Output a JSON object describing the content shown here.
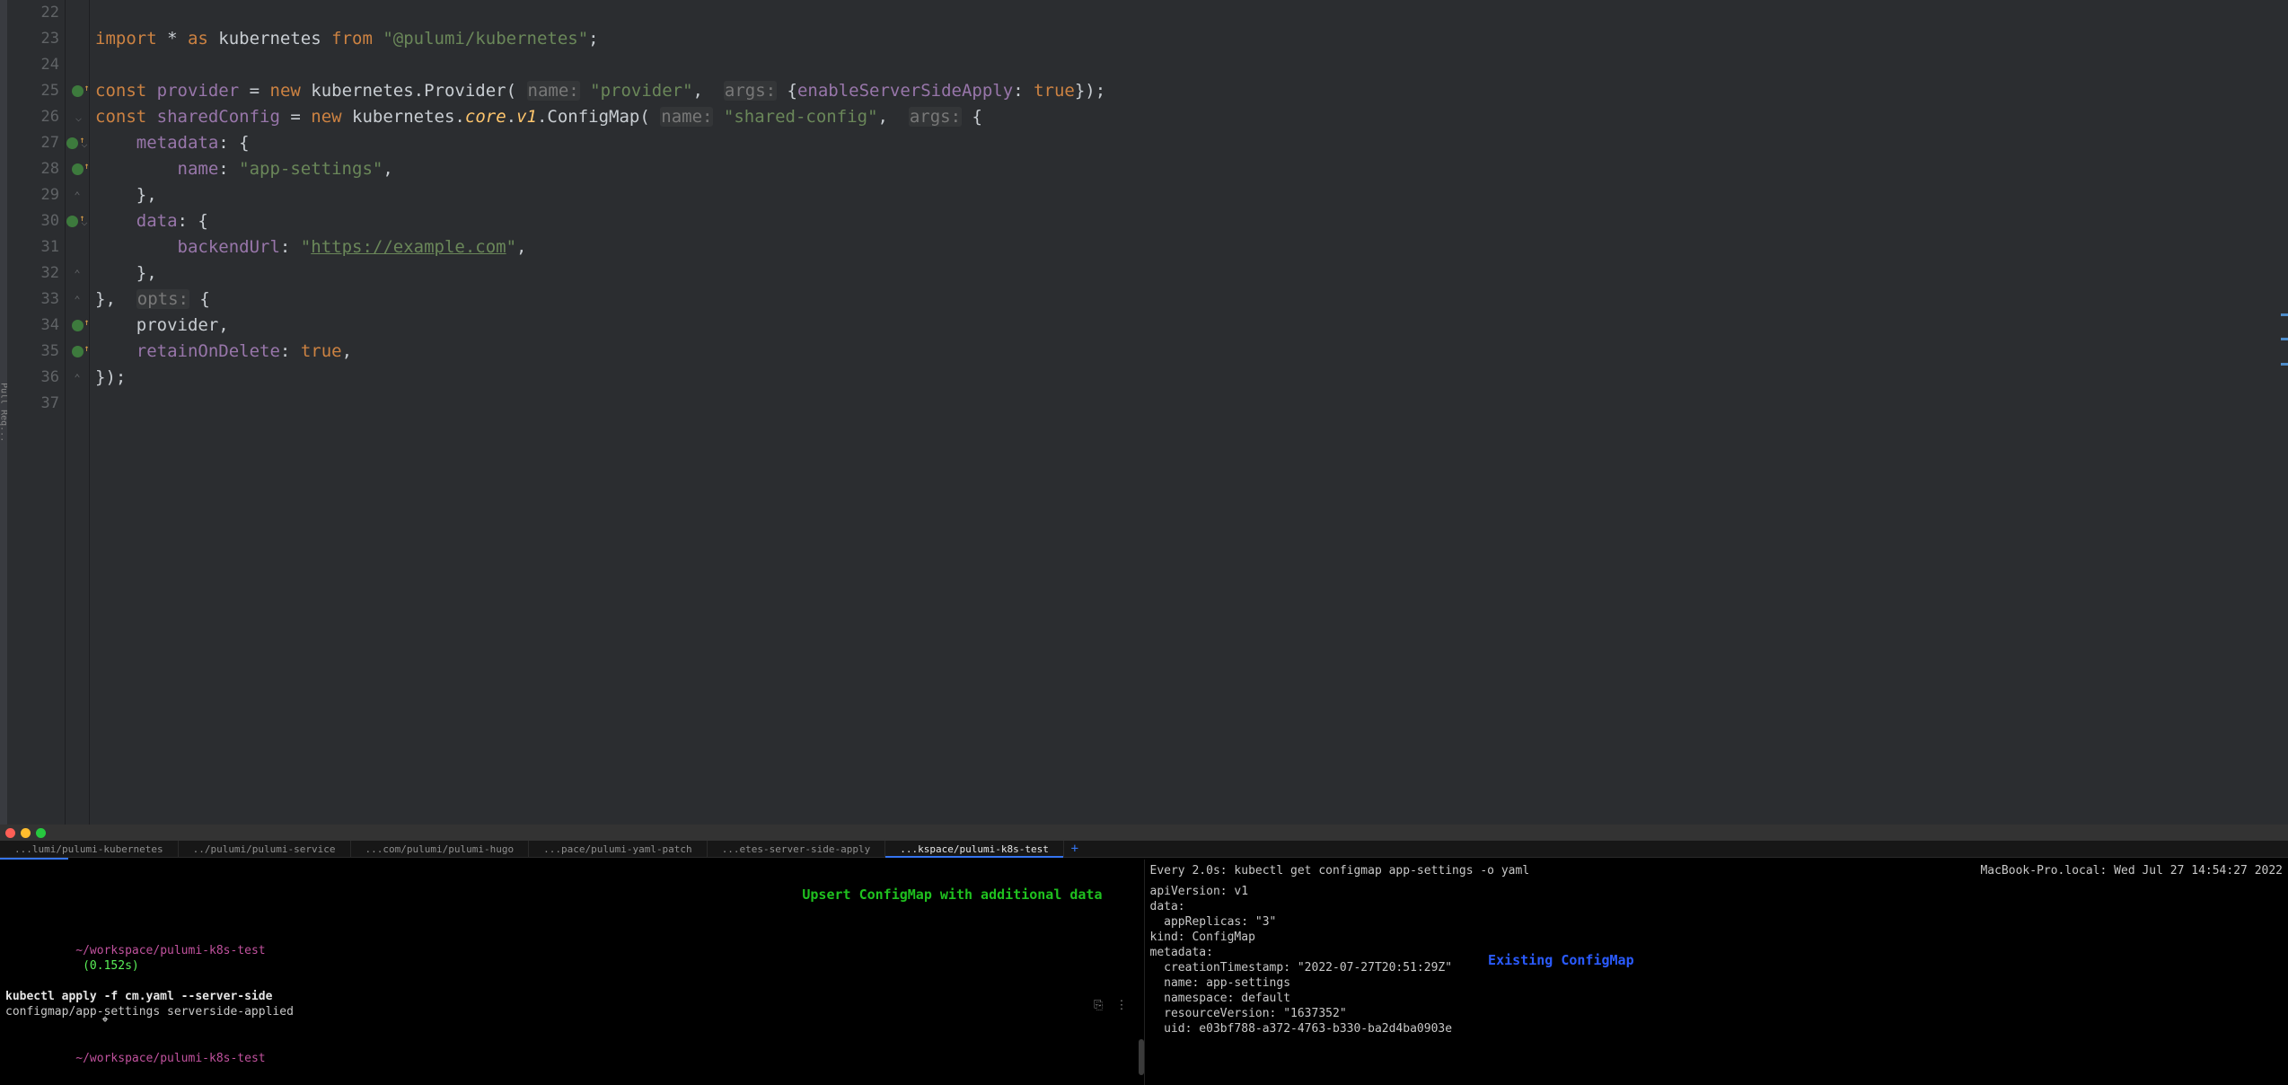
{
  "sidebar_label": "Pull Req...",
  "editor": {
    "lines": [
      {
        "n": 22,
        "mark": "",
        "html": ""
      },
      {
        "n": 23,
        "mark": "",
        "html": "<span class='kw'>import</span> * <span class='kw'>as</span> kubernetes <span class='kw'>from</span> <span class='str'>\"@pulumi/kubernetes\"</span>;"
      },
      {
        "n": 24,
        "mark": "",
        "html": ""
      },
      {
        "n": 25,
        "mark": "hint",
        "html": "<span class='kw'>const</span> <span class='pp'>provider</span> = <span class='kw'>new</span> kubernetes.Provider( <span class='ht'>name:</span> <span class='str'>\"provider\"</span>,  <span class='ht'>args:</span> {<span class='pp'>enableServerSideApply</span>: <span class='kw'>true</span>});"
      },
      {
        "n": 26,
        "mark": "fold",
        "html": "<span class='kw'>const</span> <span class='pp'>sharedConfig</span> = <span class='kw'>new</span> kubernetes.<span class='it'>core</span>.<span class='it'>v1</span>.ConfigMap( <span class='ht'>name:</span> <span class='str'>\"shared-config\"</span>,  <span class='ht'>args:</span> {"
      },
      {
        "n": 27,
        "mark": "hint-fold",
        "html": "    <span class='pp'>metadata</span>: {"
      },
      {
        "n": 28,
        "mark": "hint",
        "html": "        <span class='pp'>name</span>: <span class='str'>\"app-settings\"</span>,"
      },
      {
        "n": 29,
        "mark": "fold-end",
        "html": "    },"
      },
      {
        "n": 30,
        "mark": "hint-fold",
        "html": "    <span class='pp'>data</span>: {"
      },
      {
        "n": 31,
        "mark": "",
        "html": "        <span class='pp'>backendUrl</span>: <span class='str'>\"<a>https://example.com</a>\"</span>,"
      },
      {
        "n": 32,
        "mark": "fold-end",
        "html": "    },"
      },
      {
        "n": 33,
        "mark": "fold-end",
        "html": "},  <span class='ht'>opts:</span> {"
      },
      {
        "n": 34,
        "mark": "hint",
        "html": "    provider,"
      },
      {
        "n": 35,
        "mark": "hint",
        "html": "    <span class='pp'>retainOnDelete</span>: <span class='kw'>true</span>,"
      },
      {
        "n": 36,
        "mark": "fold-end",
        "html": "});"
      },
      {
        "n": 37,
        "mark": "",
        "html": ""
      }
    ]
  },
  "terminal": {
    "tabs": [
      "...lumi/pulumi-kubernetes",
      "../pulumi/pulumi-service",
      "...com/pulumi/pulumi-hugo",
      "...pace/pulumi-yaml-patch",
      "...etes-server-side-apply",
      "...kspace/pulumi-k8s-test"
    ],
    "active_tab": 5,
    "left": {
      "banner": "Upsert ConfigMap with additional data",
      "cwd_first": "~/workspace/pulumi-k8s-test",
      "timing": "(0.152s)",
      "cmd": "kubectl apply -f cm.yaml --server-side",
      "result": "configmap/app-settings serverside-applied",
      "cwd_second": "~/workspace/pulumi-k8s-test",
      "icons": {
        "bookmark": "⎘",
        "more": "⋮"
      }
    },
    "right": {
      "watch_left": "Every 2.0s: kubectl get configmap app-settings -o yaml",
      "watch_right": "MacBook-Pro.local: Wed Jul 27 14:54:27 2022",
      "banner": "Existing ConfigMap",
      "yaml": [
        "apiVersion: v1",
        "data:",
        "  appReplicas: \"3\"",
        "kind: ConfigMap",
        "metadata:",
        "  creationTimestamp: \"2022-07-27T20:51:29Z\"",
        "  name: app-settings",
        "  namespace: default",
        "  resourceVersion: \"1637352\"",
        "  uid: e03bf788-a372-4763-b330-ba2d4ba0903e"
      ]
    }
  }
}
